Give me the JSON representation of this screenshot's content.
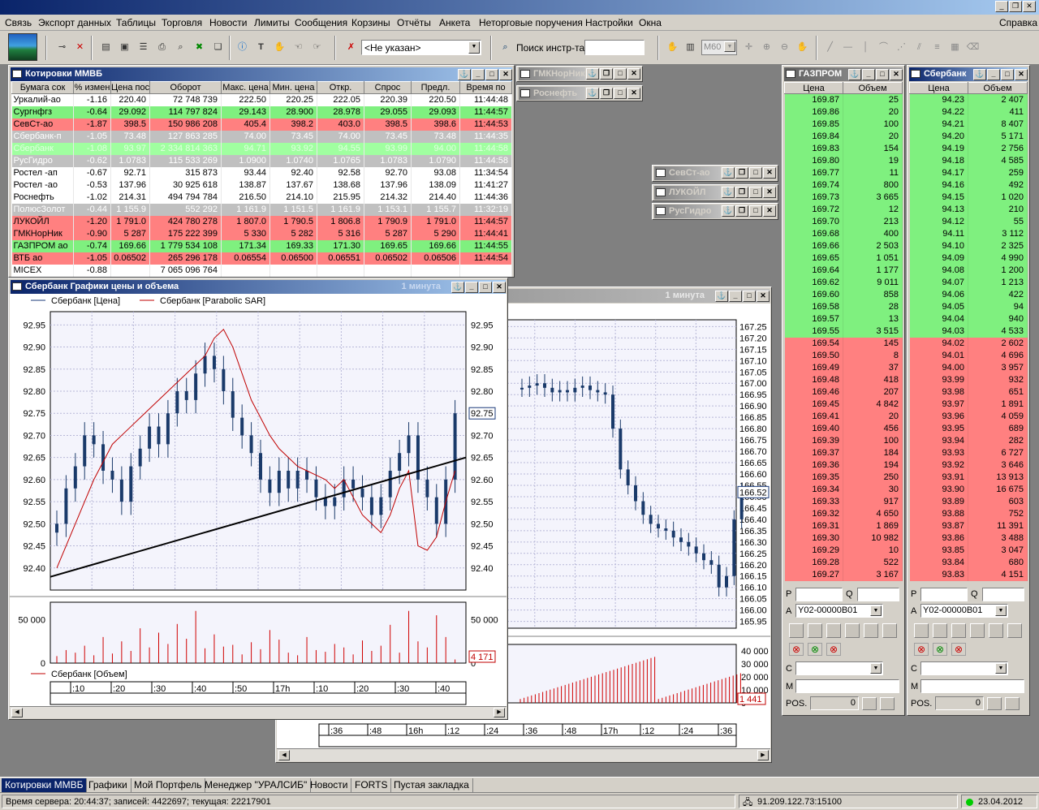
{
  "app": {
    "left_caption": "Связь",
    "help": "Справка"
  },
  "menu": [
    "Связь",
    "Экспорт данных",
    "Таблицы",
    "Торговля",
    "Новости",
    "Лимиты",
    "Сообщения",
    "Корзины",
    "Отчёты",
    "Анкета",
    "Неторговые поручения",
    "Настройки",
    "Окна"
  ],
  "toolbar": {
    "account_select": "<Не указан>",
    "search_label": "Поиск инстр-та",
    "search_value": "",
    "timeframe": "M60"
  },
  "quotes": {
    "title": "Котировки ММВБ",
    "columns": [
      "Бумага сок",
      "% измен",
      "Цена пос",
      "Оборот",
      "Макс. цена",
      "Мин. цена",
      "Откр.",
      "Спрос",
      "Предл.",
      "Время по"
    ],
    "rows": [
      {
        "c": "w",
        "v": [
          "Уркалий-ао",
          "-1.16",
          "220.40",
          "72 748 739",
          "222.50",
          "220.25",
          "222.05",
          "220.39",
          "220.50",
          "11:44:48"
        ]
      },
      {
        "c": "g",
        "v": [
          "Сургнфгз",
          "-0.64",
          "29.092",
          "114 797 824",
          "29.143",
          "28.900",
          "28.978",
          "29.055",
          "29.093",
          "11:44:57"
        ]
      },
      {
        "c": "r",
        "v": [
          "СевСт-ао",
          "-1.87",
          "398.5",
          "150 986 208",
          "405.4",
          "398.2",
          "403.0",
          "398.5",
          "398.6",
          "11:44:53"
        ]
      },
      {
        "c": "gr",
        "v": [
          "Сбербанк-п",
          "-1.05",
          "73.48",
          "127 863 285",
          "74.00",
          "73.45",
          "74.00",
          "73.45",
          "73.48",
          "11:44:35"
        ]
      },
      {
        "c": "lg",
        "v": [
          "Сбербанк",
          "-1.08",
          "93.97",
          "2 334 814 363",
          "94.71",
          "93.92",
          "94.55",
          "93.99",
          "94.00",
          "11:44:58"
        ]
      },
      {
        "c": "gr",
        "v": [
          "РусГидро",
          "-0.62",
          "1.0783",
          "115 533 269",
          "1.0900",
          "1.0740",
          "1.0765",
          "1.0783",
          "1.0790",
          "11:44:58"
        ]
      },
      {
        "c": "w",
        "v": [
          "Ростел -ап",
          "-0.67",
          "92.71",
          "315 873",
          "93.44",
          "92.40",
          "92.58",
          "92.70",
          "93.08",
          "11:34:54"
        ]
      },
      {
        "c": "w",
        "v": [
          "Ростел -ао",
          "-0.53",
          "137.96",
          "30 925 618",
          "138.87",
          "137.67",
          "138.68",
          "137.96",
          "138.09",
          "11:41:27"
        ]
      },
      {
        "c": "w",
        "v": [
          "Роснефть",
          "-1.02",
          "214.31",
          "494 794 784",
          "216.50",
          "214.10",
          "215.95",
          "214.32",
          "214.40",
          "11:44:36"
        ]
      },
      {
        "c": "gr",
        "v": [
          "ПолюсЗолот",
          "-0.44",
          "1 155.9",
          "552 292",
          "1 161.9",
          "1 151.5",
          "1 161.9",
          "1 153.1",
          "1 155.7",
          "11:32:19"
        ]
      },
      {
        "c": "r",
        "v": [
          "ЛУКОЙЛ",
          "-1.20",
          "1 791.0",
          "424 780 278",
          "1 807.0",
          "1 790.5",
          "1 806.8",
          "1 790.9",
          "1 791.0",
          "11:44:57"
        ]
      },
      {
        "c": "r",
        "v": [
          "ГМКНорНик",
          "-0.90",
          "5 287",
          "175 222 399",
          "5 330",
          "5 282",
          "5 316",
          "5 287",
          "5 290",
          "11:44:41"
        ]
      },
      {
        "c": "g",
        "v": [
          "ГАЗПРОМ ао",
          "-0.74",
          "169.66",
          "1 779 534 108",
          "171.34",
          "169.33",
          "171.30",
          "169.65",
          "169.66",
          "11:44:55"
        ]
      },
      {
        "c": "r",
        "v": [
          "ВТБ ао",
          "-1.05",
          "0.06502",
          "265 296 178",
          "0.06554",
          "0.06500",
          "0.06551",
          "0.06502",
          "0.06506",
          "11:44:54"
        ]
      },
      {
        "c": "w",
        "v": [
          "MICEX",
          "-0.88",
          "",
          "7 065 096 764",
          "",
          "",
          "",
          "",
          "",
          ""
        ]
      }
    ]
  },
  "mini_windows": [
    "ГМКНорНик",
    "Роснефть",
    "СевСт-ао",
    "ЛУКОЙЛ",
    "РусГидро"
  ],
  "chart_sber": {
    "title": "Сбербанк Графики цены и объема",
    "interval": "1 минута",
    "legend_price": "Сбербанк [Цена]",
    "legend_sar": "Сбербанк [Parabolic SAR]",
    "legend_vol": "Сбербанк [Объем]",
    "last_price": "92.75",
    "last_volume": "4 171"
  },
  "chart_gazprom": {
    "interval": "1 минута",
    "last_price": "166.52",
    "last_volume": "1 441"
  },
  "chart_data": [
    {
      "type": "candlestick",
      "title": "Сбербанк Графики цены и объема",
      "series_names": [
        "Сбербанк [Цена]",
        "Сбербанк [Parabolic SAR]",
        "Сбербанк [Объем]"
      ],
      "ylim": [
        92.35,
        92.98
      ],
      "yticks": [
        "92.95",
        "92.90",
        "92.85",
        "92.80",
        "92.75",
        "92.70",
        "92.65",
        "92.60",
        "92.55",
        "92.50",
        "92.45",
        "92.40"
      ],
      "vol_ticks": [
        "50 000",
        "0"
      ],
      "x_ticks": [
        ":10",
        ":20",
        ":30",
        ":40",
        ":50",
        "17h",
        ":10",
        ":20",
        ":30",
        ":40"
      ],
      "close": [
        92.5,
        92.58,
        92.63,
        92.7,
        92.68,
        92.62,
        92.6,
        92.55,
        92.63,
        92.67,
        92.72,
        92.68,
        92.75,
        92.8,
        92.78,
        92.84,
        92.88,
        92.85,
        92.8,
        92.74,
        92.7,
        92.66,
        92.6,
        92.57,
        92.62,
        92.58,
        92.62,
        92.6,
        92.56,
        92.54,
        92.56,
        92.6,
        92.58,
        92.56,
        92.52,
        92.56,
        92.62,
        92.66,
        92.7,
        92.6,
        92.56,
        92.5,
        92.6,
        92.75
      ],
      "sar": [
        92.4,
        92.45,
        92.5,
        92.55,
        92.6,
        92.64,
        92.68,
        92.7,
        92.72,
        92.74,
        92.76,
        92.78,
        92.8,
        92.82,
        92.84,
        92.86,
        92.88,
        92.92,
        92.94,
        92.9,
        92.84,
        92.78,
        92.74,
        92.7,
        92.67,
        92.65,
        92.63,
        92.62,
        92.61,
        92.6,
        92.58,
        92.6,
        92.56,
        92.52,
        92.5,
        92.48,
        92.52,
        92.58,
        92.62,
        92.45,
        92.44,
        92.47,
        92.55,
        92.62
      ],
      "volume": [
        8000,
        15000,
        12000,
        20000,
        9000,
        30000,
        11000,
        25000,
        14000,
        40000,
        18000,
        35000,
        22000,
        45000,
        28000,
        60000,
        17000,
        33000,
        19000,
        21000,
        10000,
        24000,
        16000,
        38000,
        27000,
        12000,
        9000,
        30000,
        15000,
        13000,
        22000,
        18000,
        10000,
        26000,
        14000,
        20000,
        44000,
        12000,
        60000,
        25000,
        18000,
        55000,
        30000,
        4171
      ],
      "trendline": {
        "from": 92.38,
        "to": 92.65
      }
    },
    {
      "type": "candlestick",
      "title": "ГАЗПРОМ",
      "ylim": [
        165.92,
        167.28
      ],
      "yticks": [
        "167.25",
        "167.20",
        "167.15",
        "167.10",
        "167.05",
        "167.00",
        "166.95",
        "166.90",
        "166.85",
        "166.80",
        "166.75",
        "166.70",
        "166.65",
        "166.60",
        "166.55",
        "166.50",
        "166.45",
        "166.40",
        "166.35",
        "166.30",
        "166.25",
        "166.20",
        "166.15",
        "166.10",
        "166.05",
        "166.00",
        "165.95"
      ],
      "vol_ticks": [
        "40 000",
        "30 000",
        "20 000",
        "10 000",
        "0"
      ],
      "x_ticks": [
        ":36",
        ":48",
        "16h",
        ":12",
        ":24",
        ":36",
        ":48",
        "17h",
        ":12",
        ":24",
        ":36"
      ],
      "close": [
        166.98,
        166.99,
        167.0,
        166.98,
        166.96,
        166.97,
        166.96,
        166.98,
        166.99,
        166.97,
        166.96,
        166.95,
        166.8,
        166.62,
        166.55,
        166.48,
        166.42,
        166.38,
        166.36,
        166.35,
        166.32,
        166.3,
        166.28,
        166.25,
        166.22,
        166.2,
        166.1,
        166.15,
        166.4,
        166.52
      ]
    }
  ],
  "depth_gazprom": {
    "title": "ГАЗПРОМ",
    "col_price": "Цена",
    "col_vol": "Объем",
    "bids": [
      [
        "169.87",
        "25"
      ],
      [
        "169.86",
        "20"
      ],
      [
        "169.85",
        "100"
      ],
      [
        "169.84",
        "20"
      ],
      [
        "169.83",
        "154"
      ],
      [
        "169.80",
        "19"
      ],
      [
        "169.77",
        "11"
      ],
      [
        "169.74",
        "800"
      ],
      [
        "169.73",
        "3 665"
      ],
      [
        "169.72",
        "12"
      ],
      [
        "169.70",
        "213"
      ],
      [
        "169.68",
        "400"
      ],
      [
        "169.66",
        "2 503"
      ],
      [
        "169.65",
        "1 051"
      ],
      [
        "169.64",
        "1 177"
      ],
      [
        "169.62",
        "9 011"
      ],
      [
        "169.60",
        "858"
      ],
      [
        "169.58",
        "28"
      ],
      [
        "169.57",
        "13"
      ],
      [
        "169.55",
        "3 515"
      ]
    ],
    "asks": [
      [
        "169.54",
        "145"
      ],
      [
        "169.50",
        "8"
      ],
      [
        "169.49",
        "37"
      ],
      [
        "169.48",
        "418"
      ],
      [
        "169.46",
        "207"
      ],
      [
        "169.45",
        "4 842"
      ],
      [
        "169.41",
        "20"
      ],
      [
        "169.40",
        "456"
      ],
      [
        "169.39",
        "100"
      ],
      [
        "169.37",
        "184"
      ],
      [
        "169.36",
        "194"
      ],
      [
        "169.35",
        "250"
      ],
      [
        "169.34",
        "30"
      ],
      [
        "169.33",
        "917"
      ],
      [
        "169.32",
        "4 650"
      ],
      [
        "169.31",
        "1 869"
      ],
      [
        "169.30",
        "10 982"
      ],
      [
        "169.29",
        "10"
      ],
      [
        "169.28",
        "522"
      ],
      [
        "169.27",
        "3 167"
      ]
    ],
    "account": "Y02-00000B01",
    "pos_label": "POS.",
    "pos_value": "0"
  },
  "depth_sber": {
    "title": "Сбербанк",
    "col_price": "Цена",
    "col_vol": "Объем",
    "bids": [
      [
        "94.23",
        "2 407"
      ],
      [
        "94.22",
        "411"
      ],
      [
        "94.21",
        "8 407"
      ],
      [
        "94.20",
        "5 171"
      ],
      [
        "94.19",
        "2 756"
      ],
      [
        "94.18",
        "4 585"
      ],
      [
        "94.17",
        "259"
      ],
      [
        "94.16",
        "492"
      ],
      [
        "94.15",
        "1 020"
      ],
      [
        "94.13",
        "210"
      ],
      [
        "94.12",
        "55"
      ],
      [
        "94.11",
        "3 112"
      ],
      [
        "94.10",
        "2 325"
      ],
      [
        "94.09",
        "4 990"
      ],
      [
        "94.08",
        "1 200"
      ],
      [
        "94.07",
        "1 213"
      ],
      [
        "94.06",
        "422"
      ],
      [
        "94.05",
        "94"
      ],
      [
        "94.04",
        "940"
      ],
      [
        "94.03",
        "4 533"
      ]
    ],
    "asks": [
      [
        "94.02",
        "2 602"
      ],
      [
        "94.01",
        "4 696"
      ],
      [
        "94.00",
        "3 957"
      ],
      [
        "93.99",
        "932"
      ],
      [
        "93.98",
        "651"
      ],
      [
        "93.97",
        "1 891"
      ],
      [
        "93.96",
        "4 059"
      ],
      [
        "93.95",
        "689"
      ],
      [
        "93.94",
        "282"
      ],
      [
        "93.93",
        "6 727"
      ],
      [
        "93.92",
        "3 646"
      ],
      [
        "93.91",
        "13 913"
      ],
      [
        "93.90",
        "16 675"
      ],
      [
        "93.89",
        "603"
      ],
      [
        "93.88",
        "752"
      ],
      [
        "93.87",
        "11 391"
      ],
      [
        "93.86",
        "3 488"
      ],
      [
        "93.85",
        "3 047"
      ],
      [
        "93.84",
        "680"
      ],
      [
        "93.83",
        "4 151"
      ]
    ],
    "account": "Y02-00000B01",
    "pos_label": "POS.",
    "pos_value": "0"
  },
  "order_labels": {
    "p": "P",
    "q": "Q",
    "a": "A",
    "c": "C",
    "m": "M"
  },
  "tabs": [
    "Котировки ММВБ",
    "Графики",
    "Мой Портфель",
    "Менеджер \"УРАЛСИБ\"",
    "Новости",
    "FORTS",
    "Пустая закладка"
  ],
  "status": {
    "server": "Время сервера: 20:44:37; записей: 4422697; текущая: 22217901",
    "ip": "91.209.122.73:15100",
    "date": "23.04.2012"
  }
}
